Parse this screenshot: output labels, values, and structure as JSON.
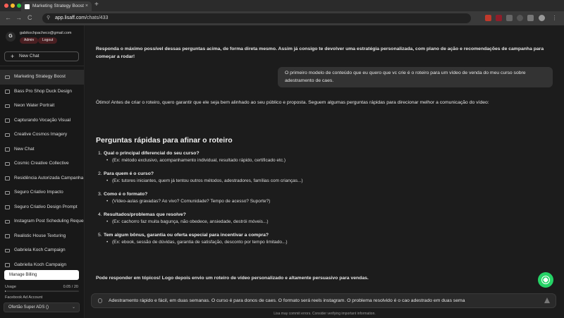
{
  "browser": {
    "tab_title": "Marketing Strategy Boost",
    "tab_close": "×",
    "new_tab": "+",
    "url_host": "app.lisaff.com",
    "url_path": "/chats/433",
    "back": "←",
    "forward": "→",
    "reload": "C"
  },
  "sidebar": {
    "avatar_letter": "G",
    "email": "gabikochpacheco@gmail.com",
    "admin_label": "Admin",
    "logout_label": "Logout",
    "new_chat_label": "New Chat",
    "new_chat_icon": "+",
    "chats": [
      "Marketing Strategy Boost",
      "Bass Pro Shop Duck Design",
      "Neon Water Portrait",
      "Capturando Vocação Visual",
      "Creative Cosmos Imagery",
      "New Chat",
      "Cosmic Creative Collective",
      "Residência Autorizada Campanha",
      "Seguro Criativo Impacto",
      "Seguro Criativo Design Prompt",
      "Instagram Post Scheduling Request",
      "Realistic House Texturing",
      "Gabriela Koch Campaign",
      "Gabriella Koch Campaign"
    ],
    "manage_billing": "Manage Billing",
    "usage_label": "Usage",
    "usage_value": "0.05 / 20",
    "usage_fraction": 0.0025,
    "fb_label": "Facebook Ad Account",
    "fb_selected": "Ofertão Super ADS ()",
    "fb_chevron": "⌄"
  },
  "chat": {
    "intro": "Responda o máximo possível dessas perguntas acima, de forma direta mesmo. Assim já consigo te devolver uma estratégia personalizada, com plano de ação e recomendações de campanha para começar a rodar!",
    "user_message": "O primeiro modelo de conteúdo que eu quero que vc crie é o roteiro para um vídeo de venda do meu curso sobre adestramento de caes.",
    "reply_intro": "Ótimo! Antes de criar o roteiro, quero garantir que ele seja bem alinhado ao seu público e proposta. Seguem algumas perguntas rápidas para direcionar melhor a comunicação do vídeo:",
    "heading": "Perguntas rápidas para afinar o roteiro",
    "questions": [
      {
        "num": "1.",
        "title": "Qual o principal diferencial do seu curso?",
        "detail": "(Ex: método exclusivo, acompanhamento individual, resultado rápido, certificado etc.)"
      },
      {
        "num": "2.",
        "title": "Para quem é o curso?",
        "detail": "(Ex: tutores iniciantes, quem já tentou outros métodos, adestradores, famílias com crianças...)"
      },
      {
        "num": "3.",
        "title": "Como é o formato?",
        "detail": "(Vídeo-aulas gravadas? Ao vivo? Comunidade? Tempo de acesso? Suporte?)"
      },
      {
        "num": "4.",
        "title": "Resultados/problemas que resolve?",
        "detail": "(Ex: cachorro faz muita bagunça, não obedece, ansiedade, destrói móveis...)"
      },
      {
        "num": "5.",
        "title": "Tem algum bônus, garantia ou oferta especial para incentivar a compra?",
        "detail": "(Ex: ebook, sessão de dúvidas, garantia de satisfação, desconto por tempo limitado...)"
      }
    ],
    "bullet": "•",
    "closing": "Pode responder em tópicos! Logo depois envio um roteiro de vídeo personalizado e altamente persuasivo para vendas.",
    "input_value": "Adestramento rápido e fácil, em duas semanas. O curso é para donos de caes. O formato será reels instagram. O problema resolvido é o cao adestrado em duas sema",
    "disclaimer": "Lisa may commit errors. Consider verifying important information."
  },
  "colors": {
    "whatsapp": "#25d366",
    "admin_pill": "#4a1f22"
  },
  "icons": {
    "lock": "lock-icon",
    "clip": "paperclip-icon",
    "send": "send-icon",
    "whatsapp": "whatsapp-icon",
    "chat": "chat-bubble-icon"
  }
}
